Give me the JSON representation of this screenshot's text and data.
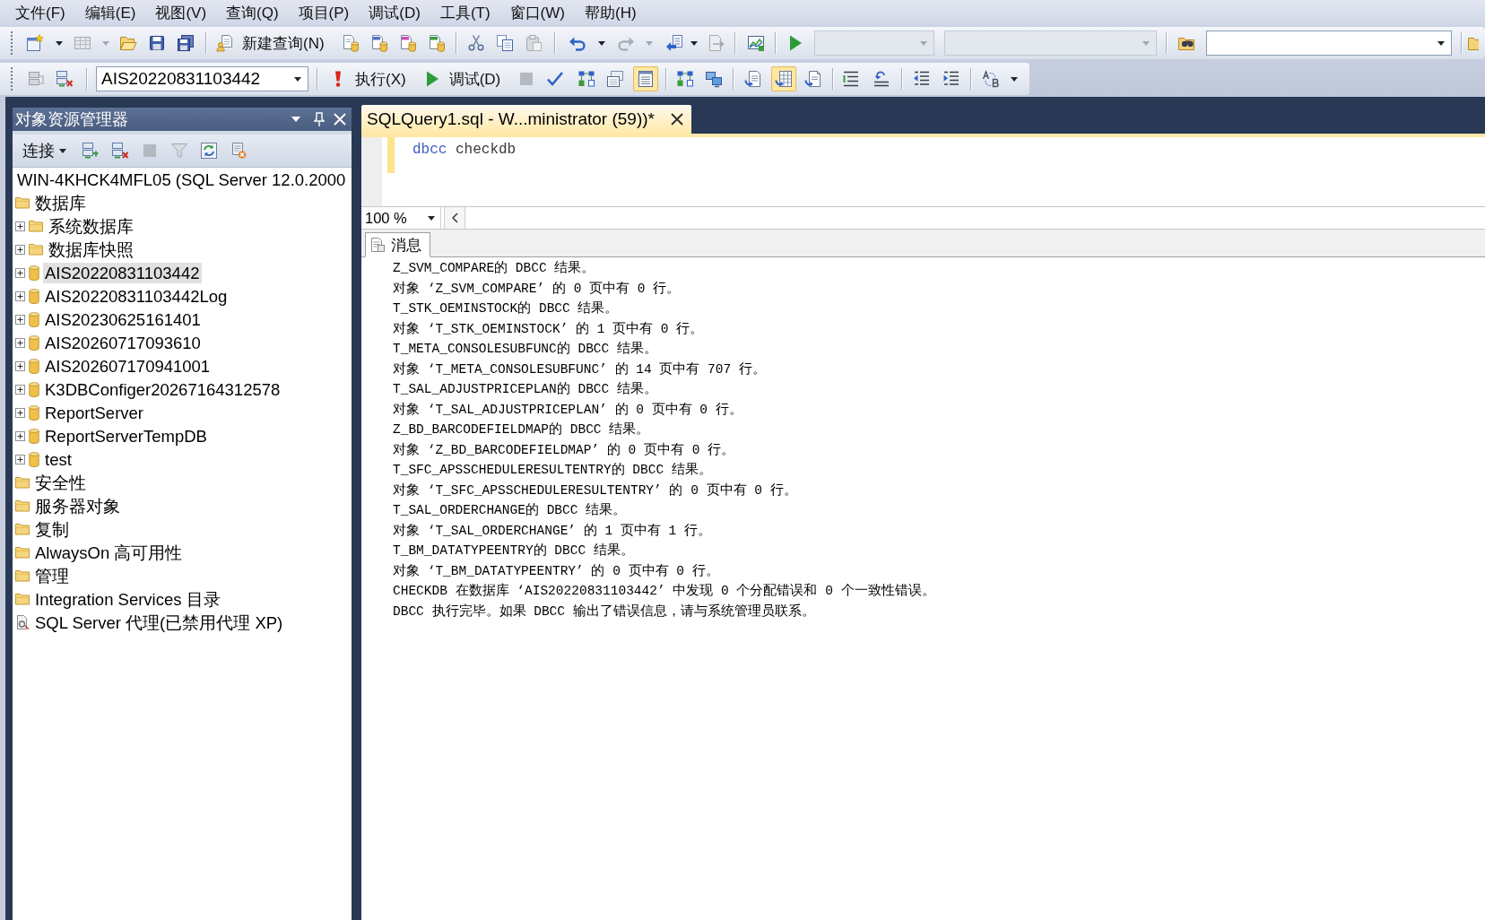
{
  "menu_bar": [
    "文件(F)",
    "编辑(E)",
    "视图(V)",
    "查询(Q)",
    "项目(P)",
    "调试(D)",
    "工具(T)",
    "窗口(W)",
    "帮助(H)"
  ],
  "toolbar_1": {
    "new_query": "新建查询(N)",
    "combos": [
      {
        "disabled": true
      },
      {
        "disabled": true
      },
      {
        "disabled": false
      }
    ]
  },
  "toolbar_2": {
    "database": "AIS20220831103442",
    "execute": "执行(X)",
    "debug": "调试(D)",
    "toggles": [
      {
        "on": false
      },
      {
        "on": true
      }
    ],
    "result_modes": [
      {
        "selected": false
      },
      {
        "selected": true
      },
      {
        "selected": false
      }
    ]
  },
  "object_explorer": {
    "title": "对象资源管理器",
    "connect": "连接",
    "tree": [
      {
        "label": "WIN-4KHCK4MFL05 (SQL Server 12.0.2000",
        "selected": false,
        "children": [
          {
            "label": "数据库",
            "kind": "folder",
            "selected": false,
            "children": [
              {
                "label": "系统数据库",
                "kind": "folder",
                "expanded": false,
                "selected": false
              },
              {
                "label": "数据库快照",
                "kind": "folder",
                "expanded": false,
                "selected": false
              },
              {
                "label": "AIS20220831103442",
                "kind": "database",
                "expanded": false,
                "selected": true
              },
              {
                "label": "AIS20220831103442Log",
                "kind": "database",
                "expanded": false,
                "selected": false
              },
              {
                "label": "AIS20230625161401",
                "kind": "database",
                "expanded": false,
                "selected": false
              },
              {
                "label": "AIS20260717093610",
                "kind": "database",
                "expanded": false,
                "selected": false
              },
              {
                "label": "AIS202607170941001",
                "kind": "database",
                "expanded": false,
                "selected": false
              },
              {
                "label": "K3DBConfiger20267164312578",
                "kind": "database",
                "expanded": false,
                "selected": false
              },
              {
                "label": "ReportServer",
                "kind": "database",
                "expanded": false,
                "selected": false
              },
              {
                "label": "ReportServerTempDB",
                "kind": "database",
                "expanded": false,
                "selected": false
              },
              {
                "label": "test",
                "kind": "database",
                "expanded": false,
                "selected": false
              }
            ]
          },
          {
            "label": "安全性",
            "kind": "folder",
            "selected": false
          },
          {
            "label": "服务器对象",
            "kind": "folder",
            "selected": false
          },
          {
            "label": "复制",
            "kind": "folder",
            "selected": false
          },
          {
            "label": "AlwaysOn 高可用性",
            "kind": "folder",
            "selected": false
          },
          {
            "label": "管理",
            "kind": "folder",
            "selected": false
          },
          {
            "label": "Integration Services 目录",
            "kind": "folder",
            "selected": false
          },
          {
            "label": "SQL Server 代理(已禁用代理 XP)",
            "kind": "agent",
            "selected": false
          }
        ]
      }
    ]
  },
  "document_tabs": [
    {
      "label": "SQLQuery1.sql - W...ministrator (59))*",
      "selected": true
    }
  ],
  "editor": {
    "lines": [
      {
        "modified": true,
        "tokens": [
          {
            "kind": "keyword",
            "text": "dbcc"
          },
          {
            "kind": "plain",
            "text": "checkdb"
          }
        ]
      }
    ]
  },
  "zoom_level": "100 %",
  "results": {
    "tabs": [
      {
        "label": "消息",
        "selected": true
      }
    ],
    "messages": [
      "Z_SVM_COMPARE的 DBCC 结果。",
      "对象 ‘Z_SVM_COMPARE’ 的 0 页中有 0 行。",
      "T_STK_OEMINSTOCK的 DBCC 结果。",
      "对象 ‘T_STK_OEMINSTOCK’ 的 1 页中有 0 行。",
      "T_META_CONSOLESUBFUNC的 DBCC 结果。",
      "对象 ‘T_META_CONSOLESUBFUNC’ 的 14 页中有 707 行。",
      "T_SAL_ADJUSTPRICEPLAN的 DBCC 结果。",
      "对象 ‘T_SAL_ADJUSTPRICEPLAN’ 的 0 页中有 0 行。",
      "Z_BD_BARCODEFIELDMAP的 DBCC 结果。",
      "对象 ‘Z_BD_BARCODEFIELDMAP’ 的 0 页中有 0 行。",
      "T_SFC_APSSCHEDULERESULTENTRY的 DBCC 结果。",
      "对象 ‘T_SFC_APSSCHEDULERESULTENTRY’ 的 0 页中有 0 行。",
      "T_SAL_ORDERCHANGE的 DBCC 结果。",
      "对象 ‘T_SAL_ORDERCHANGE’ 的 1 页中有 1 行。",
      "T_BM_DATATYPEENTRY的 DBCC 结果。",
      "对象 ‘T_BM_DATATYPEENTRY’ 的 0 页中有 0 行。",
      "CHECKDB 在数据库 ‘AIS20220831103442’ 中发现 0 个分配错误和 0 个一致性错误。",
      "DBCC 执行完毕。如果 DBCC 输出了错误信息，请与系统管理员联系。"
    ]
  }
}
